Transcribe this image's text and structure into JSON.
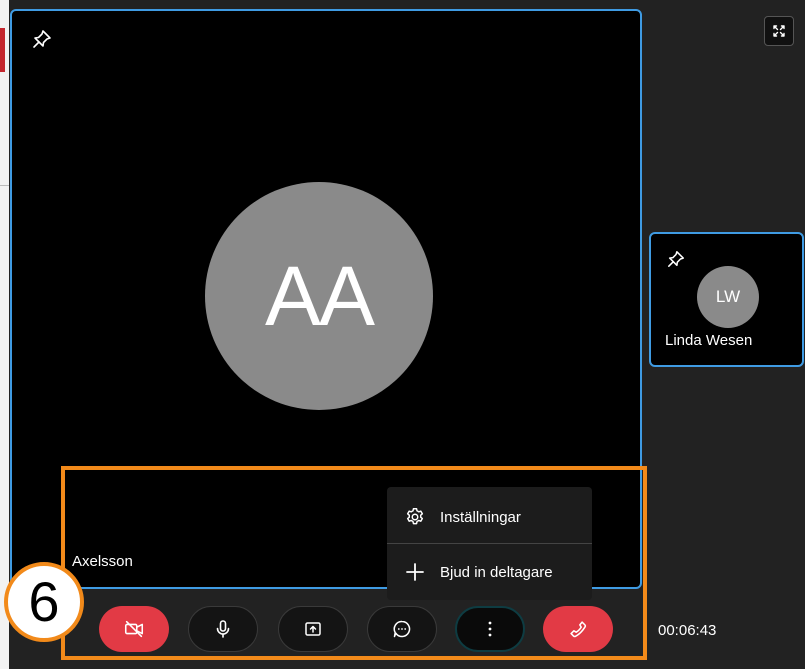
{
  "main_participant": {
    "initials": "AA",
    "name": "Axelsson"
  },
  "side_participant": {
    "initials": "LW",
    "name": "Linda Wesen"
  },
  "menu": {
    "items": [
      {
        "label": "Inställningar",
        "icon": "gear-icon"
      },
      {
        "label": "Bjud in deltagare",
        "icon": "plus-icon"
      }
    ]
  },
  "toolbar": {
    "buttons": [
      {
        "name": "camera-off",
        "icon": "video-off-icon",
        "state": "off"
      },
      {
        "name": "microphone",
        "icon": "microphone-icon",
        "state": "on"
      },
      {
        "name": "share-screen",
        "icon": "share-screen-icon",
        "state": "idle"
      },
      {
        "name": "chat",
        "icon": "chat-icon",
        "state": "idle"
      },
      {
        "name": "more-options",
        "icon": "more-vertical-icon",
        "state": "active"
      },
      {
        "name": "hang-up",
        "icon": "phone-icon",
        "state": "danger"
      }
    ]
  },
  "call": {
    "duration": "00:06:43"
  },
  "annotation": {
    "step_number": "6"
  },
  "colors": {
    "tile_border": "#3f9be3",
    "avatar": "#8a8a8a",
    "danger": "#e23a45",
    "annotation": "#f28a1a",
    "background": "#222222"
  }
}
